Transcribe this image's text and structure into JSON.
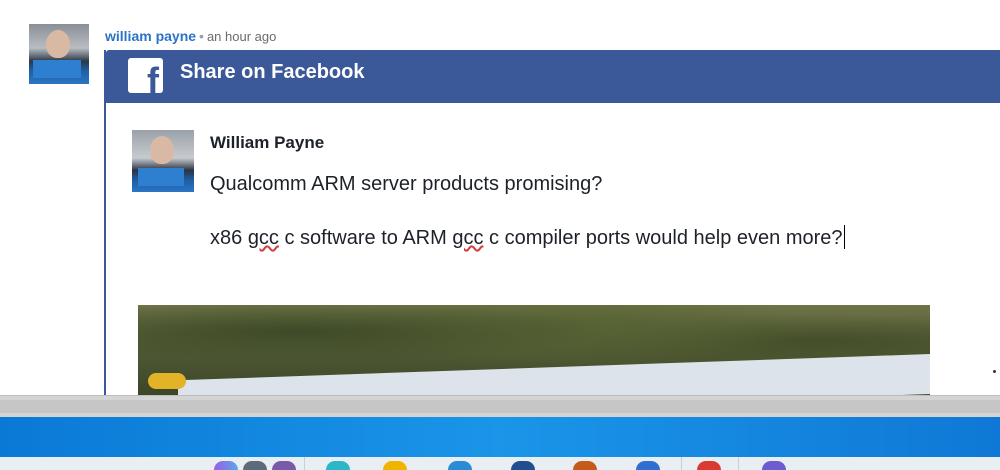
{
  "comment": {
    "author": "william payne",
    "separator": "•",
    "time": "an hour ago"
  },
  "share": {
    "logo_letter": "f",
    "title": "Share on Facebook",
    "post": {
      "name": "William Payne",
      "line1": "Qualcomm ARM server products promising?",
      "line2_a": "x86 ",
      "line2_b": "gcc",
      "line2_c": " c software to ARM ",
      "line2_d": "gcc",
      "line2_e": " c compiler ports would help even more?"
    }
  },
  "taskbar": {
    "icons": [
      "copilot-icon",
      "file-explorer-icon",
      "edge-icon",
      "store-icon",
      "app-icon",
      "chrome-icon",
      "app-icon-2"
    ]
  }
}
